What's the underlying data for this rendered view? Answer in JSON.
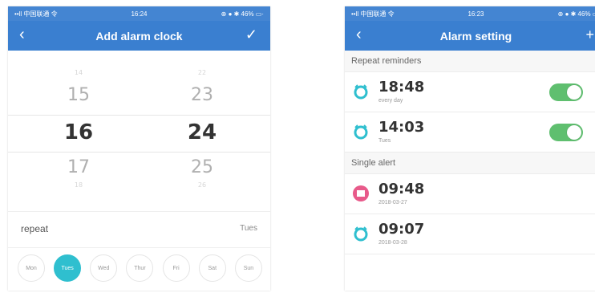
{
  "left": {
    "status": {
      "left": "••ll 中国联通 令",
      "center": "16:24",
      "right": "⊕ ● ✱ 46% ▭·"
    },
    "nav": {
      "back_icon": "chevron-left-icon",
      "title": "Add alarm clock",
      "confirm_icon": "check-icon"
    },
    "picker": {
      "hours": {
        "far_above": "14",
        "above": "15",
        "selected": "16",
        "below": "17",
        "far_below": "18"
      },
      "minutes": {
        "far_above": "22",
        "above": "23",
        "selected": "24",
        "below": "25",
        "far_below": "26"
      }
    },
    "repeat": {
      "label": "repeat",
      "value": "Tues"
    },
    "days": [
      {
        "label": "Mon",
        "selected": false
      },
      {
        "label": "Tues",
        "selected": true
      },
      {
        "label": "Wed",
        "selected": false
      },
      {
        "label": "Thur",
        "selected": false
      },
      {
        "label": "Fri",
        "selected": false
      },
      {
        "label": "Sat",
        "selected": false
      },
      {
        "label": "Sun",
        "selected": false
      }
    ]
  },
  "right": {
    "status": {
      "left": "••ll 中国联通 令",
      "center": "16:23",
      "right": "⊕ ● ✱ 46% ▭·"
    },
    "nav": {
      "back_icon": "chevron-left-icon",
      "title": "Alarm setting",
      "add_icon": "plus-icon"
    },
    "repeat_section": {
      "title": "Repeat reminders",
      "items": [
        {
          "time": "18:48",
          "sub": "every day",
          "enabled": true
        },
        {
          "time": "14:03",
          "sub": "Tues",
          "enabled": true
        }
      ]
    },
    "single_section": {
      "title": "Single alert",
      "items": [
        {
          "time": "09:48",
          "sub": "2018-03-27",
          "icon": "pink"
        },
        {
          "time": "09:07",
          "sub": "2018-03-28",
          "icon": "teal"
        }
      ]
    }
  },
  "colors": {
    "header": "#3a7fd0",
    "accent": "#2fbfcf",
    "toggle_on": "#5fbf6f",
    "alert_pink": "#e85a8a"
  }
}
